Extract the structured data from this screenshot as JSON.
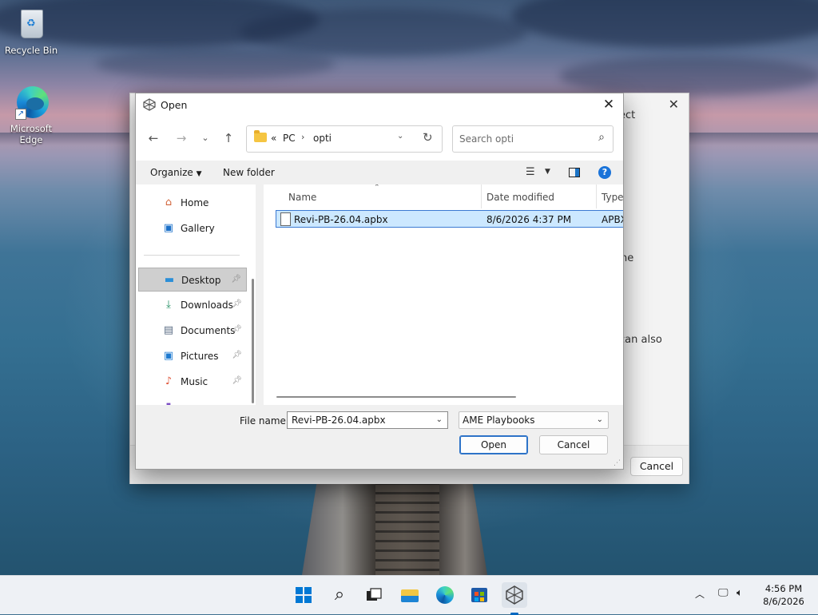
{
  "desktop": {
    "icons": [
      {
        "label": "Recycle Bin",
        "icon": "recycle-bin-icon"
      },
      {
        "label": "Microsoft Edge",
        "icon": "edge-icon"
      }
    ]
  },
  "background_dialog": {
    "partial_texts": [
      "ect",
      "ne",
      "can also"
    ],
    "cancel_label": "Cancel"
  },
  "dialog": {
    "title": "Open",
    "address": {
      "overflow": "«",
      "crumbs": [
        "PC",
        "opti"
      ]
    },
    "search_placeholder": "Search opti",
    "commands": {
      "organize": "Organize",
      "new_folder": "New folder"
    },
    "sidebar": {
      "items": [
        {
          "label": "Home",
          "icon": "home-icon",
          "pinned": false
        },
        {
          "label": "Gallery",
          "icon": "gallery-icon",
          "pinned": false
        },
        {
          "label": "Desktop",
          "icon": "desktop-icon",
          "pinned": true,
          "selected": true
        },
        {
          "label": "Downloads",
          "icon": "downloads-icon",
          "pinned": true
        },
        {
          "label": "Documents",
          "icon": "documents-icon",
          "pinned": true
        },
        {
          "label": "Pictures",
          "icon": "pictures-icon",
          "pinned": true
        },
        {
          "label": "Music",
          "icon": "music-icon",
          "pinned": true
        }
      ]
    },
    "columns": [
      "Name",
      "Date modified",
      "Type"
    ],
    "files": [
      {
        "name": "Revi-PB-26.04.apbx",
        "date_modified": "8/6/2026 4:37 PM",
        "type": "APBX",
        "selected": true
      }
    ],
    "file_name_label": "File name:",
    "file_name_value": "Revi-PB-26.04.apbx",
    "file_type": "AME Playbooks",
    "open_label": "Open",
    "cancel_label": "Cancel"
  },
  "taskbar": {
    "apps": [
      "start-icon",
      "search-icon",
      "task-view-icon",
      "file-explorer-icon",
      "edge-icon",
      "store-icon",
      "ame-wizard-icon"
    ],
    "clock": {
      "time": "4:56 PM",
      "date": "8/6/2026"
    }
  }
}
